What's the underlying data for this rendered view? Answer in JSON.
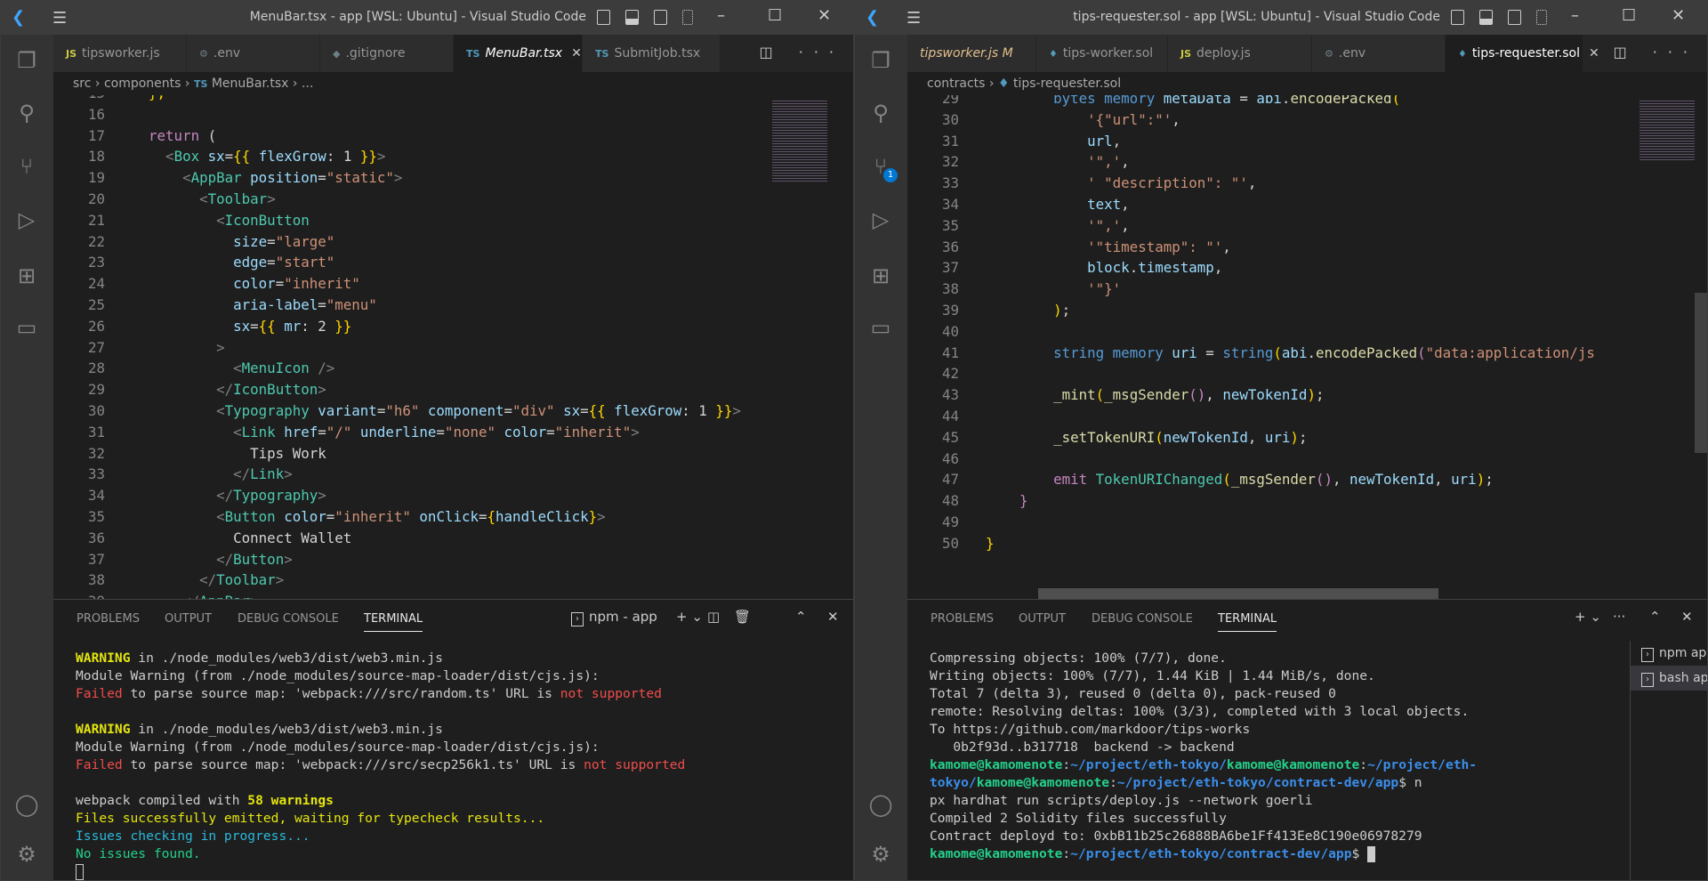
{
  "left": {
    "title": "MenuBar.tsx - app [WSL: Ubuntu] - Visual Studio Code",
    "tabs": [
      {
        "icon": "JS",
        "icon_color": "#cbcb41",
        "label": "tipsworker.js"
      },
      {
        "icon": "⚙",
        "icon_color": "#6d8086",
        "label": ".env"
      },
      {
        "icon": "◆",
        "icon_color": "#6d8086",
        "label": ".gitignore"
      },
      {
        "icon": "TS",
        "icon_color": "#519aba",
        "label": "MenuBar.tsx",
        "active": true
      },
      {
        "icon": "TS",
        "icon_color": "#519aba",
        "label": "SubmitJob.tsx"
      }
    ],
    "breadcrumb": [
      "src",
      "components",
      "MenuBar.tsx",
      "..."
    ],
    "code": [
      {
        "n": "15",
        "t": [
          [
            "b",
            "  };"
          ]
        ]
      },
      {
        "n": "16",
        "t": []
      },
      {
        "n": "17",
        "t": [
          [
            "k",
            "  return "
          ],
          [
            "t",
            "("
          ]
        ]
      },
      {
        "n": "18",
        "t": [
          [
            "p",
            "    <"
          ],
          [
            "tg",
            "Box"
          ],
          [
            "at",
            " sx"
          ],
          [
            "t",
            "="
          ],
          [
            "b",
            "{{"
          ],
          [
            "at",
            " flexGrow"
          ],
          [
            "t",
            ": 1 "
          ],
          [
            "b",
            "}}"
          ],
          [
            "p",
            ">"
          ]
        ]
      },
      {
        "n": "19",
        "t": [
          [
            "p",
            "      <"
          ],
          [
            "tg",
            "AppBar"
          ],
          [
            "at",
            " position"
          ],
          [
            "t",
            "="
          ],
          [
            "s",
            "\"static\""
          ],
          [
            "p",
            ">"
          ]
        ]
      },
      {
        "n": "20",
        "t": [
          [
            "p",
            "        <"
          ],
          [
            "tg",
            "Toolbar"
          ],
          [
            "p",
            ">"
          ]
        ]
      },
      {
        "n": "21",
        "t": [
          [
            "p",
            "          <"
          ],
          [
            "tg",
            "IconButton"
          ]
        ]
      },
      {
        "n": "22",
        "t": [
          [
            "at",
            "            size"
          ],
          [
            "t",
            "="
          ],
          [
            "s",
            "\"large\""
          ]
        ]
      },
      {
        "n": "23",
        "t": [
          [
            "at",
            "            edge"
          ],
          [
            "t",
            "="
          ],
          [
            "s",
            "\"start\""
          ]
        ]
      },
      {
        "n": "24",
        "t": [
          [
            "at",
            "            color"
          ],
          [
            "t",
            "="
          ],
          [
            "s",
            "\"inherit\""
          ]
        ]
      },
      {
        "n": "25",
        "t": [
          [
            "at",
            "            aria-label"
          ],
          [
            "t",
            "="
          ],
          [
            "s",
            "\"menu\""
          ]
        ]
      },
      {
        "n": "26",
        "t": [
          [
            "at",
            "            sx"
          ],
          [
            "t",
            "="
          ],
          [
            "b",
            "{{"
          ],
          [
            "at",
            " mr"
          ],
          [
            "t",
            ": 2 "
          ],
          [
            "b",
            "}}"
          ]
        ]
      },
      {
        "n": "27",
        "t": [
          [
            "p",
            "          >"
          ]
        ]
      },
      {
        "n": "28",
        "t": [
          [
            "p",
            "            <"
          ],
          [
            "tg",
            "MenuIcon"
          ],
          [
            "p",
            " />"
          ]
        ]
      },
      {
        "n": "29",
        "t": [
          [
            "p",
            "          </"
          ],
          [
            "tg",
            "IconButton"
          ],
          [
            "p",
            ">"
          ]
        ]
      },
      {
        "n": "30",
        "t": [
          [
            "p",
            "          <"
          ],
          [
            "tg",
            "Typography"
          ],
          [
            "at",
            " variant"
          ],
          [
            "t",
            "="
          ],
          [
            "s",
            "\"h6\""
          ],
          [
            "at",
            " component"
          ],
          [
            "t",
            "="
          ],
          [
            "s",
            "\"div\""
          ],
          [
            "at",
            " sx"
          ],
          [
            "t",
            "="
          ],
          [
            "b",
            "{{"
          ],
          [
            "at",
            " flexGrow"
          ],
          [
            "t",
            ": 1 "
          ],
          [
            "b",
            "}}"
          ],
          [
            "p",
            ">"
          ]
        ]
      },
      {
        "n": "31",
        "t": [
          [
            "p",
            "            <"
          ],
          [
            "tg",
            "Link"
          ],
          [
            "at",
            " href"
          ],
          [
            "t",
            "="
          ],
          [
            "s",
            "\"/\""
          ],
          [
            "at",
            " underline"
          ],
          [
            "t",
            "="
          ],
          [
            "s",
            "\"none\""
          ],
          [
            "at",
            " color"
          ],
          [
            "t",
            "="
          ],
          [
            "s",
            "\"inherit\""
          ],
          [
            "p",
            ">"
          ]
        ]
      },
      {
        "n": "32",
        "t": [
          [
            "t",
            "              Tips Work"
          ]
        ]
      },
      {
        "n": "33",
        "t": [
          [
            "p",
            "            </"
          ],
          [
            "tg",
            "Link"
          ],
          [
            "p",
            ">"
          ]
        ]
      },
      {
        "n": "34",
        "t": [
          [
            "p",
            "          </"
          ],
          [
            "tg",
            "Typography"
          ],
          [
            "p",
            ">"
          ]
        ]
      },
      {
        "n": "35",
        "t": [
          [
            "p",
            "          <"
          ],
          [
            "tg",
            "Button"
          ],
          [
            "at",
            " color"
          ],
          [
            "t",
            "="
          ],
          [
            "s",
            "\"inherit\""
          ],
          [
            "at",
            " onClick"
          ],
          [
            "t",
            "="
          ],
          [
            "b",
            "{"
          ],
          [
            "v",
            "handleClick"
          ],
          [
            "b",
            "}"
          ],
          [
            "p",
            ">"
          ]
        ]
      },
      {
        "n": "36",
        "t": [
          [
            "t",
            "            Connect Wallet"
          ]
        ]
      },
      {
        "n": "37",
        "t": [
          [
            "p",
            "          </"
          ],
          [
            "tg",
            "Button"
          ],
          [
            "p",
            ">"
          ]
        ]
      },
      {
        "n": "38",
        "t": [
          [
            "p",
            "        </"
          ],
          [
            "tg",
            "Toolbar"
          ],
          [
            "p",
            ">"
          ]
        ]
      },
      {
        "n": "39",
        "t": [
          [
            "p",
            "      </"
          ],
          [
            "tg",
            "AppBar"
          ],
          [
            "p",
            ">"
          ]
        ]
      }
    ],
    "panel_tabs": [
      "PROBLEMS",
      "OUTPUT",
      "DEBUG CONSOLE",
      "TERMINAL"
    ],
    "terminal_name": "npm - app",
    "terminal": [
      [
        [
          "wY",
          "WARNING"
        ],
        [
          "tw",
          " in ./node_modules/web3/dist/web3.min.js"
        ]
      ],
      [
        [
          "tw",
          "Module Warning (from ./node_modules/source-map-loader/dist/cjs.js):"
        ]
      ],
      [
        [
          "rd",
          "Failed"
        ],
        [
          "tw",
          " to parse source map: 'webpack:///src/random.ts' URL is "
        ],
        [
          "rd",
          "not supported"
        ]
      ],
      [],
      [
        [
          "wY",
          "WARNING"
        ],
        [
          "tw",
          " in ./node_modules/web3/dist/web3.min.js"
        ]
      ],
      [
        [
          "tw",
          "Module Warning (from ./node_modules/source-map-loader/dist/cjs.js):"
        ]
      ],
      [
        [
          "rd",
          "Failed"
        ],
        [
          "tw",
          " to parse source map: 'webpack:///src/secp256k1.ts' URL is "
        ],
        [
          "rd",
          "not supported"
        ]
      ],
      [],
      [
        [
          "tw",
          "webpack compiled with "
        ],
        [
          "yb",
          "58 warnings"
        ]
      ],
      [
        [
          "yl",
          "Files successfully emitted, waiting for typecheck results..."
        ]
      ],
      [
        [
          "cy",
          "Issues checking in progress..."
        ]
      ],
      [
        [
          "gr",
          "No issues found."
        ]
      ]
    ]
  },
  "right": {
    "title": "tips-requester.sol - app [WSL: Ubuntu] - Visual Studio Code",
    "tabs": [
      {
        "icon": "",
        "icon_color": "#e2c08d",
        "label": "tipsworker.js M",
        "modified": true
      },
      {
        "icon": "♦",
        "icon_color": "#519aba",
        "label": "tips-worker.sol"
      },
      {
        "icon": "JS",
        "icon_color": "#cbcb41",
        "label": "deploy.js"
      },
      {
        "icon": "⚙",
        "icon_color": "#6d8086",
        "label": ".env"
      },
      {
        "icon": "♦",
        "icon_color": "#519aba",
        "label": "tips-requester.sol",
        "active": true
      }
    ],
    "breadcrumb": [
      "contracts",
      "tips-requester.sol"
    ],
    "scm_badge": "1",
    "code": [
      {
        "n": "29",
        "t": [
          [
            "kb",
            "        bytes"
          ],
          [
            "kb",
            " memory"
          ],
          [
            "v",
            " metaData"
          ],
          [
            "t",
            " = "
          ],
          [
            "v",
            "abi"
          ],
          [
            "t",
            "."
          ],
          [
            "f",
            "encodePacked"
          ],
          [
            "b",
            "("
          ]
        ]
      },
      {
        "n": "30",
        "t": [
          [
            "s",
            "            '{\"url\":\"'"
          ],
          [
            "t",
            ","
          ]
        ]
      },
      {
        "n": "31",
        "t": [
          [
            "v",
            "            url"
          ],
          [
            "t",
            ","
          ]
        ]
      },
      {
        "n": "32",
        "t": [
          [
            "s",
            "            '\",'"
          ],
          [
            "t",
            ","
          ]
        ]
      },
      {
        "n": "33",
        "t": [
          [
            "s",
            "            ' \"description\": \"'"
          ],
          [
            "t",
            ","
          ]
        ]
      },
      {
        "n": "34",
        "t": [
          [
            "v",
            "            text"
          ],
          [
            "t",
            ","
          ]
        ]
      },
      {
        "n": "35",
        "t": [
          [
            "s",
            "            '\",'"
          ],
          [
            "t",
            ","
          ]
        ]
      },
      {
        "n": "36",
        "t": [
          [
            "s",
            "            '\"timestamp\": \"'"
          ],
          [
            "t",
            ","
          ]
        ]
      },
      {
        "n": "37",
        "t": [
          [
            "v",
            "            block"
          ],
          [
            "t",
            "."
          ],
          [
            "v",
            "timestamp"
          ],
          [
            "t",
            ","
          ]
        ]
      },
      {
        "n": "38",
        "t": [
          [
            "s",
            "            '\"}'"
          ]
        ]
      },
      {
        "n": "39",
        "t": [
          [
            "b",
            "        )"
          ],
          [
            "t",
            ";"
          ]
        ]
      },
      {
        "n": "40",
        "t": []
      },
      {
        "n": "41",
        "t": [
          [
            "kb",
            "        string"
          ],
          [
            "kb",
            " memory"
          ],
          [
            "v",
            " uri"
          ],
          [
            "t",
            " = "
          ],
          [
            "kb",
            "string"
          ],
          [
            "b",
            "("
          ],
          [
            "v",
            "abi"
          ],
          [
            "t",
            "."
          ],
          [
            "f",
            "encodePacked"
          ],
          [
            "k",
            "("
          ],
          [
            "s",
            "\"data:application/js"
          ]
        ]
      },
      {
        "n": "42",
        "t": []
      },
      {
        "n": "43",
        "t": [
          [
            "f",
            "        _mint"
          ],
          [
            "b",
            "("
          ],
          [
            "f",
            "_msgSender"
          ],
          [
            "k",
            "()"
          ],
          [
            "t",
            ", "
          ],
          [
            "v",
            "newTokenId"
          ],
          [
            "b",
            ")"
          ],
          [
            "t",
            ";"
          ]
        ]
      },
      {
        "n": "44",
        "t": []
      },
      {
        "n": "45",
        "t": [
          [
            "f",
            "        _setTokenURI"
          ],
          [
            "b",
            "("
          ],
          [
            "v",
            "newTokenId"
          ],
          [
            "t",
            ", "
          ],
          [
            "v",
            "uri"
          ],
          [
            "b",
            ")"
          ],
          [
            "t",
            ";"
          ]
        ]
      },
      {
        "n": "46",
        "t": []
      },
      {
        "n": "47",
        "t": [
          [
            "k",
            "        emit"
          ],
          [
            "tg",
            " TokenURIChanged"
          ],
          [
            "b",
            "("
          ],
          [
            "f",
            "_msgSender"
          ],
          [
            "k",
            "()"
          ],
          [
            "t",
            ", "
          ],
          [
            "v",
            "newTokenId"
          ],
          [
            "t",
            ", "
          ],
          [
            "v",
            "uri"
          ],
          [
            "b",
            ")"
          ],
          [
            "t",
            ";"
          ]
        ]
      },
      {
        "n": "48",
        "t": [
          [
            "k",
            "    }"
          ]
        ]
      },
      {
        "n": "49",
        "t": []
      },
      {
        "n": "50",
        "t": [
          [
            "b",
            "}"
          ]
        ]
      }
    ],
    "panel_tabs": [
      "PROBLEMS",
      "OUTPUT",
      "DEBUG CONSOLE",
      "TERMINAL"
    ],
    "terminal_list": [
      "npm app",
      "bash app"
    ],
    "terminal": [
      [
        [
          "tw",
          "Compressing objects: 100% (7/7), done."
        ]
      ],
      [
        [
          "tw",
          "Writing objects: 100% (7/7), 1.44 KiB | 1.44 MiB/s, done."
        ]
      ],
      [
        [
          "tw",
          "Total 7 (delta 3), reused 0 (delta 0), pack-reused 0"
        ]
      ],
      [
        [
          "tw",
          "remote: Resolving deltas: 100% (3/3), completed with 3 local objects."
        ]
      ],
      [
        [
          "tw",
          "To https://github.com/markdoor/tips-works"
        ]
      ],
      [
        [
          "tw",
          "   0b2f93d..b317718  backend -> backend"
        ]
      ],
      [
        [
          "gb",
          "kamome@kamomenote"
        ],
        [
          "tw",
          ":"
        ],
        [
          "bb",
          "~/project/eth-tokyo/"
        ],
        [
          "gb",
          "kamome@kamomenote"
        ],
        [
          "tw",
          ":"
        ],
        [
          "bb",
          "~/project/eth-"
        ]
      ],
      [
        [
          "bb",
          "tokyo/"
        ],
        [
          "gb",
          "kamome@kamomenote"
        ],
        [
          "tw",
          ":"
        ],
        [
          "bb",
          "~/project/eth-tokyo/contract-dev/app"
        ],
        [
          "tw",
          "$ n"
        ]
      ],
      [
        [
          "tw",
          "px hardhat run scripts/deploy.js --network goerli"
        ]
      ],
      [
        [
          "tw",
          "Compiled 2 Solidity files successfully"
        ]
      ],
      [
        [
          "tw",
          "Contract deployd to: 0xbB11b25c26888BA6be1Ff413Ee8C190e06978279"
        ]
      ],
      [
        [
          "gb",
          "kamome@kamomenote"
        ],
        [
          "tw",
          ":"
        ],
        [
          "bb",
          "~/project/eth-tokyo/contract-dev/app"
        ],
        [
          "tw",
          "$ "
        ]
      ]
    ]
  }
}
